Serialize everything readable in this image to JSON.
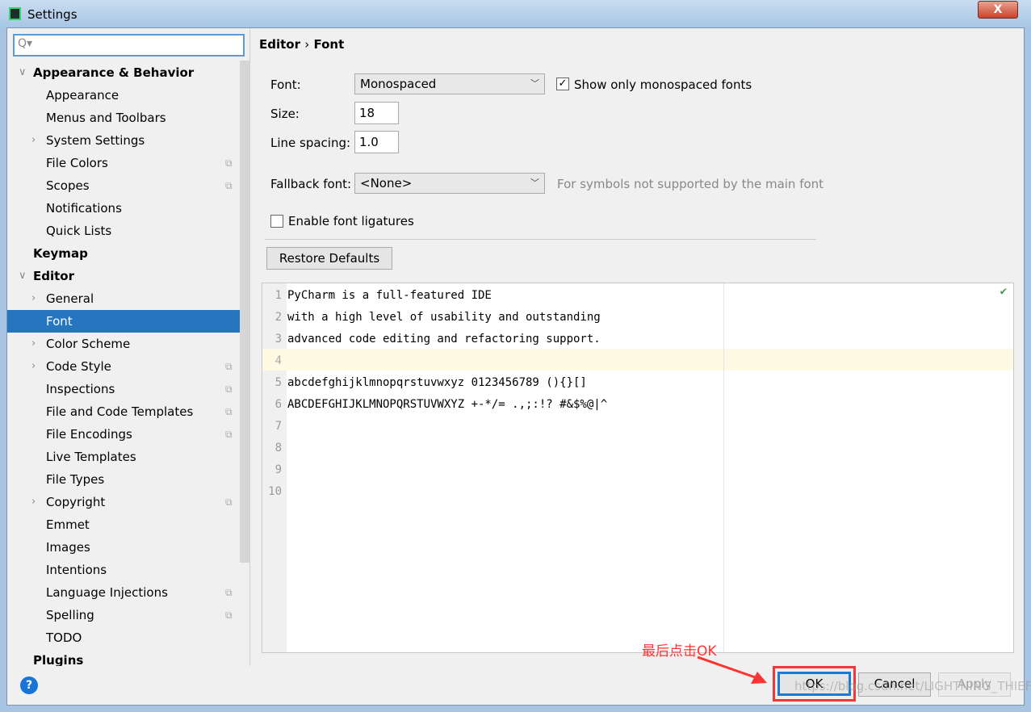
{
  "window": {
    "title": "Settings",
    "close": "X"
  },
  "search": {
    "placeholder": "Q▾"
  },
  "tree": [
    {
      "label": "Appearance & Behavior",
      "level": 0,
      "bold": true,
      "arrow": "expanded"
    },
    {
      "label": "Appearance",
      "level": 1
    },
    {
      "label": "Menus and Toolbars",
      "level": 1
    },
    {
      "label": "System Settings",
      "level": 1,
      "arrow": "collapsed"
    },
    {
      "label": "File Colors",
      "level": 1,
      "copy": true
    },
    {
      "label": "Scopes",
      "level": 1,
      "copy": true
    },
    {
      "label": "Notifications",
      "level": 1
    },
    {
      "label": "Quick Lists",
      "level": 1
    },
    {
      "label": "Keymap",
      "level": 0,
      "bold": true
    },
    {
      "label": "Editor",
      "level": 0,
      "bold": true,
      "arrow": "expanded"
    },
    {
      "label": "General",
      "level": 1,
      "arrow": "collapsed"
    },
    {
      "label": "Font",
      "level": 1,
      "selected": true
    },
    {
      "label": "Color Scheme",
      "level": 1,
      "arrow": "collapsed"
    },
    {
      "label": "Code Style",
      "level": 1,
      "arrow": "collapsed",
      "copy": true
    },
    {
      "label": "Inspections",
      "level": 1,
      "copy": true
    },
    {
      "label": "File and Code Templates",
      "level": 1,
      "copy": true
    },
    {
      "label": "File Encodings",
      "level": 1,
      "copy": true
    },
    {
      "label": "Live Templates",
      "level": 1
    },
    {
      "label": "File Types",
      "level": 1
    },
    {
      "label": "Copyright",
      "level": 1,
      "arrow": "collapsed",
      "copy": true
    },
    {
      "label": "Emmet",
      "level": 1
    },
    {
      "label": "Images",
      "level": 1
    },
    {
      "label": "Intentions",
      "level": 1
    },
    {
      "label": "Language Injections",
      "level": 1,
      "copy": true
    },
    {
      "label": "Spelling",
      "level": 1,
      "copy": true
    },
    {
      "label": "TODO",
      "level": 1
    },
    {
      "label": "Plugins",
      "level": 0,
      "bold": true
    }
  ],
  "breadcrumb": {
    "parent": "Editor",
    "sep": "›",
    "current": "Font"
  },
  "form": {
    "font_label": "Font:",
    "font_value": "Monospaced",
    "show_mono_label": "Show only monospaced fonts",
    "show_mono_checked": true,
    "size_label": "Size:",
    "size_value": "18",
    "spacing_label": "Line spacing:",
    "spacing_value": "1.0",
    "fallback_label": "Fallback font:",
    "fallback_value": "<None>",
    "fallback_hint": "For symbols not supported by the main font",
    "ligatures_label": "Enable font ligatures",
    "ligatures_checked": false,
    "restore": "Restore Defaults"
  },
  "preview": {
    "lines": [
      "PyCharm is a full-featured IDE",
      "with a high level of usability and outstanding",
      "advanced code editing and refactoring support.",
      "",
      "abcdefghijklmnopqrstuvwxyz 0123456789 (){}[]",
      "ABCDEFGHIJKLMNOPQRSTUVWXYZ +-*/= .,;:!? #&$%@|^",
      "",
      "",
      "",
      ""
    ],
    "current_line": 4
  },
  "footer": {
    "help": "?",
    "ok": "OK",
    "cancel": "Cancel",
    "apply": "Apply"
  },
  "annotation": {
    "text": "最后点击OK",
    "color": "#ff3333"
  },
  "watermark": "https://blog.csdn.net/LIGHTNING_THIEF"
}
